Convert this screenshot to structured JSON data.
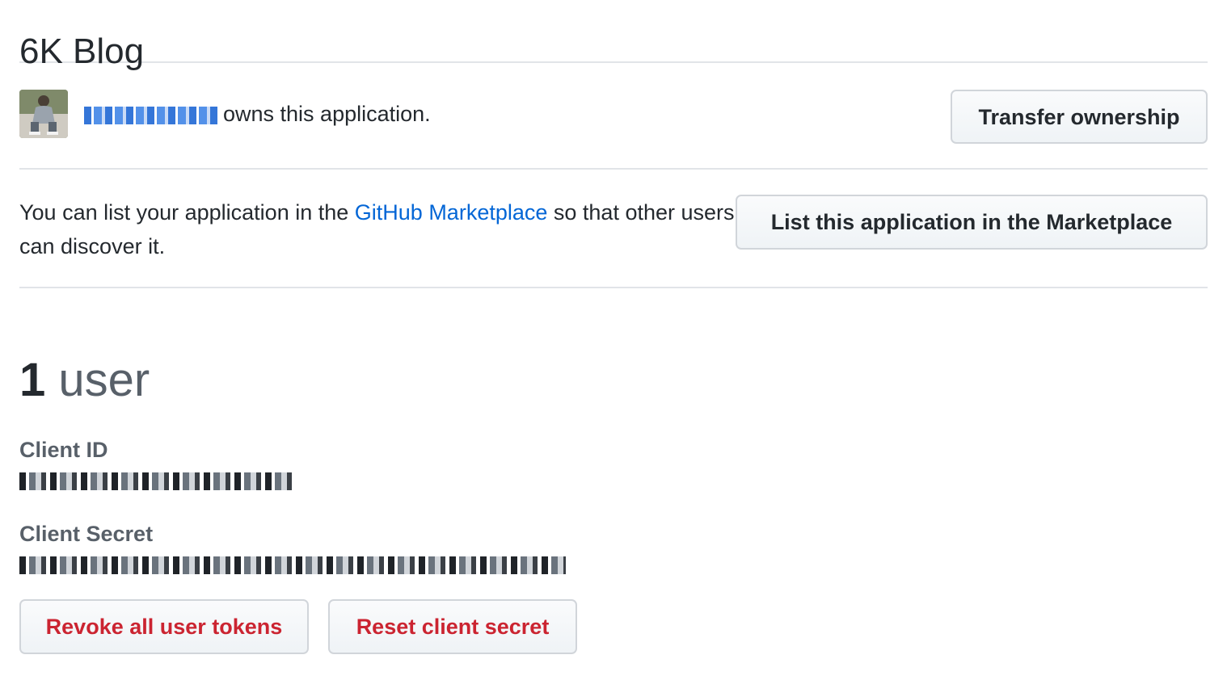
{
  "app": {
    "title": "6K Blog"
  },
  "owner": {
    "username_redacted": "",
    "owns_text": "owns this application.",
    "transfer_label": "Transfer ownership"
  },
  "marketplace": {
    "text_before": "You can list your application in the ",
    "link_text": "GitHub Marketplace",
    "text_after": " so that other users can discover it.",
    "button_label": "List this application in the Marketplace"
  },
  "users": {
    "count": "1",
    "label": "user"
  },
  "credentials": {
    "client_id_label": "Client ID",
    "client_secret_label": "Client Secret"
  },
  "actions": {
    "revoke_label": "Revoke all user tokens",
    "reset_label": "Reset client secret"
  },
  "colors": {
    "link": "#0366d6",
    "danger": "#cb2431",
    "text": "#24292e",
    "muted": "#586069",
    "border": "#e1e4e8"
  },
  "icons": {
    "avatar": "user-avatar-photo"
  }
}
